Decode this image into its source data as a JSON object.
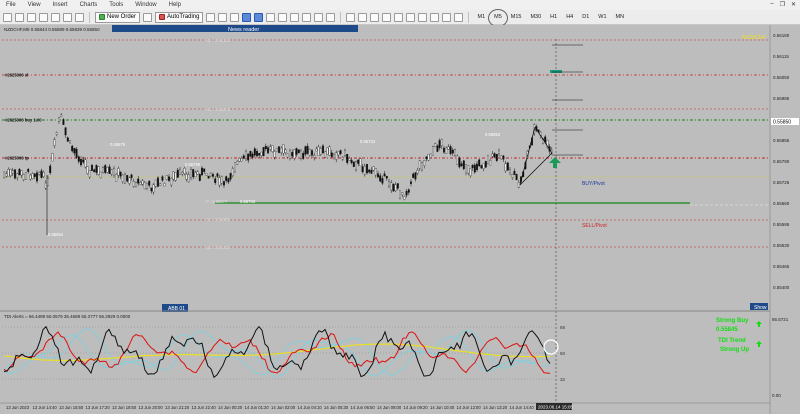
{
  "menu": {
    "items": [
      "File",
      "View",
      "Insert",
      "Charts",
      "Tools",
      "Window",
      "Help"
    ]
  },
  "toolbar": {
    "new_order": "New Order",
    "autotrading": "AutoTrading",
    "timeframes": [
      "M1",
      "M5",
      "M15",
      "M30",
      "H1",
      "H4",
      "D1",
      "W1",
      "MN"
    ],
    "active_timeframe": "M5"
  },
  "chart": {
    "symbol_info": "NZDCHF,M5  0.55844 0.55889 0.55839 0.55850",
    "news_reader": "News reader",
    "right_label": "NZD/CHF",
    "buy_pivot": "BUY/Pivot",
    "sell_pivot": "SELL/Pivot",
    "current_price": "0.55850",
    "level_labels": [
      {
        "text": "R2 : 0.56124",
        "price": 0.56124,
        "color": "#cc2222"
      },
      {
        "text": "R1 : 0.55993",
        "price": 0.55993,
        "color": "#cc2222"
      },
      {
        "text": "P : 0.55877",
        "price": 0.55877,
        "color": "#22aa22"
      },
      {
        "text": "S1 : 0.55686",
        "price": 0.55686,
        "color": "#cc2222"
      },
      {
        "text": "S2 : 0.55415",
        "price": 0.55415,
        "color": "#cc2222"
      }
    ],
    "left_tags": [
      "#2625006 sl",
      "#2625006 buy 1.00",
      "#2625006 tp"
    ],
    "price_axis": [
      "0.56180",
      "0.56115",
      "0.56050",
      "0.55985",
      "0.55920",
      "0.55855",
      "0.55790",
      "0.55725",
      "0.55660",
      "0.55595",
      "0.55530",
      "0.55465",
      "0.55400"
    ],
    "time_axis": [
      "13 Jun 2023",
      "13 Jun 14:40",
      "13 Jun 15:50",
      "13 Jun 17:20",
      "13 Jun 18:50",
      "13 Jun 20:00",
      "13 Jun 21:20",
      "13 Jun 22:40",
      "14 Jun 00:20",
      "14 Jun 01:30",
      "14 Jun 02:00",
      "14 Jun 04:10",
      "14 Jun 05:30",
      "14 Jun 06:50",
      "14 Jun 08:00",
      "14 Jun 09:20",
      "14 Jun 10:40",
      "14 Jun 12:00",
      "14 Jun 13:20",
      "14 Jun 14:40"
    ],
    "cursor_time": "2023.06.14 15:05",
    "bottom_badge": "ABB 01",
    "show_button": "Show",
    "mini_labels": [
      "0.55879",
      "0.55789",
      "0.55703",
      "0.55723",
      "0.55853",
      "0.55654"
    ]
  },
  "tdi": {
    "header": "TDI Alerts = 66.4489 50.0579 35.4688 65.3777 56.2929 0.0000",
    "level_68": "68",
    "level_50": "50",
    "level_32": "32",
    "axis_top": "86.5721",
    "axis_bottom": "0.00",
    "strong_buy": "Strong Buy",
    "strong_buy_price": "0.55845",
    "tdi_trend": "TDI Trend",
    "strong_up": "Strong Up"
  },
  "colors": {
    "bg": "#bdbdbd",
    "candle": "#111111",
    "buy_line": "#118811",
    "sell_line": "#cc2222",
    "cyan": "#6fd5e8",
    "yellow": "#f0e01a",
    "red": "#dd1111",
    "green_text": "#11dd11"
  }
}
